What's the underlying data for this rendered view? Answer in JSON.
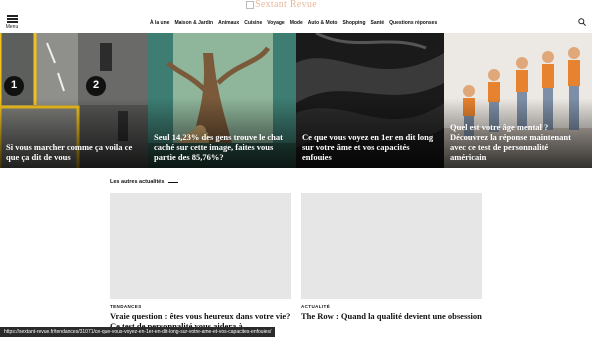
{
  "header": {
    "menu_label": "Menu",
    "logo_text": "Sextant Revue"
  },
  "nav": [
    "À la une",
    "Maison & Jardin",
    "Animaux",
    "Cuisine",
    "Voyage",
    "Mode",
    "Auto & Moto",
    "Shopping",
    "Santé",
    "Questions réponses"
  ],
  "hero": [
    {
      "title": "Si vous marcher comme ça voila ce que ça dit de vous",
      "badges": [
        "1",
        "2"
      ]
    },
    {
      "title": "Seul 14,23% des gens trouve le chat caché sur cette image, faites vous partie des 85,76%?"
    },
    {
      "title": "Ce que vous voyez en 1er en dit long sur votre âme et vos capacités enfouies"
    },
    {
      "title": "Quel est votre âge mental ? Découvrez la réponse maintenant avec ce test de personnalité américain"
    }
  ],
  "section": {
    "title": "Les autres actualités"
  },
  "articles": [
    {
      "tag": "TENDANCES",
      "title": "Vraie question : êtes vous heureux dans votre vie? Ce test de personnalité vous aidera à"
    },
    {
      "tag": "ACTUALITÉ",
      "title": "The Row : Quand la qualité devient une obsession"
    }
  ],
  "status_url": "https://sextant-revue.fr/tendances/31071/ce-que-vous-voyez-en-1er-en-dit-long-sur-votre-ame-et-vos-capacites-enfouies/"
}
